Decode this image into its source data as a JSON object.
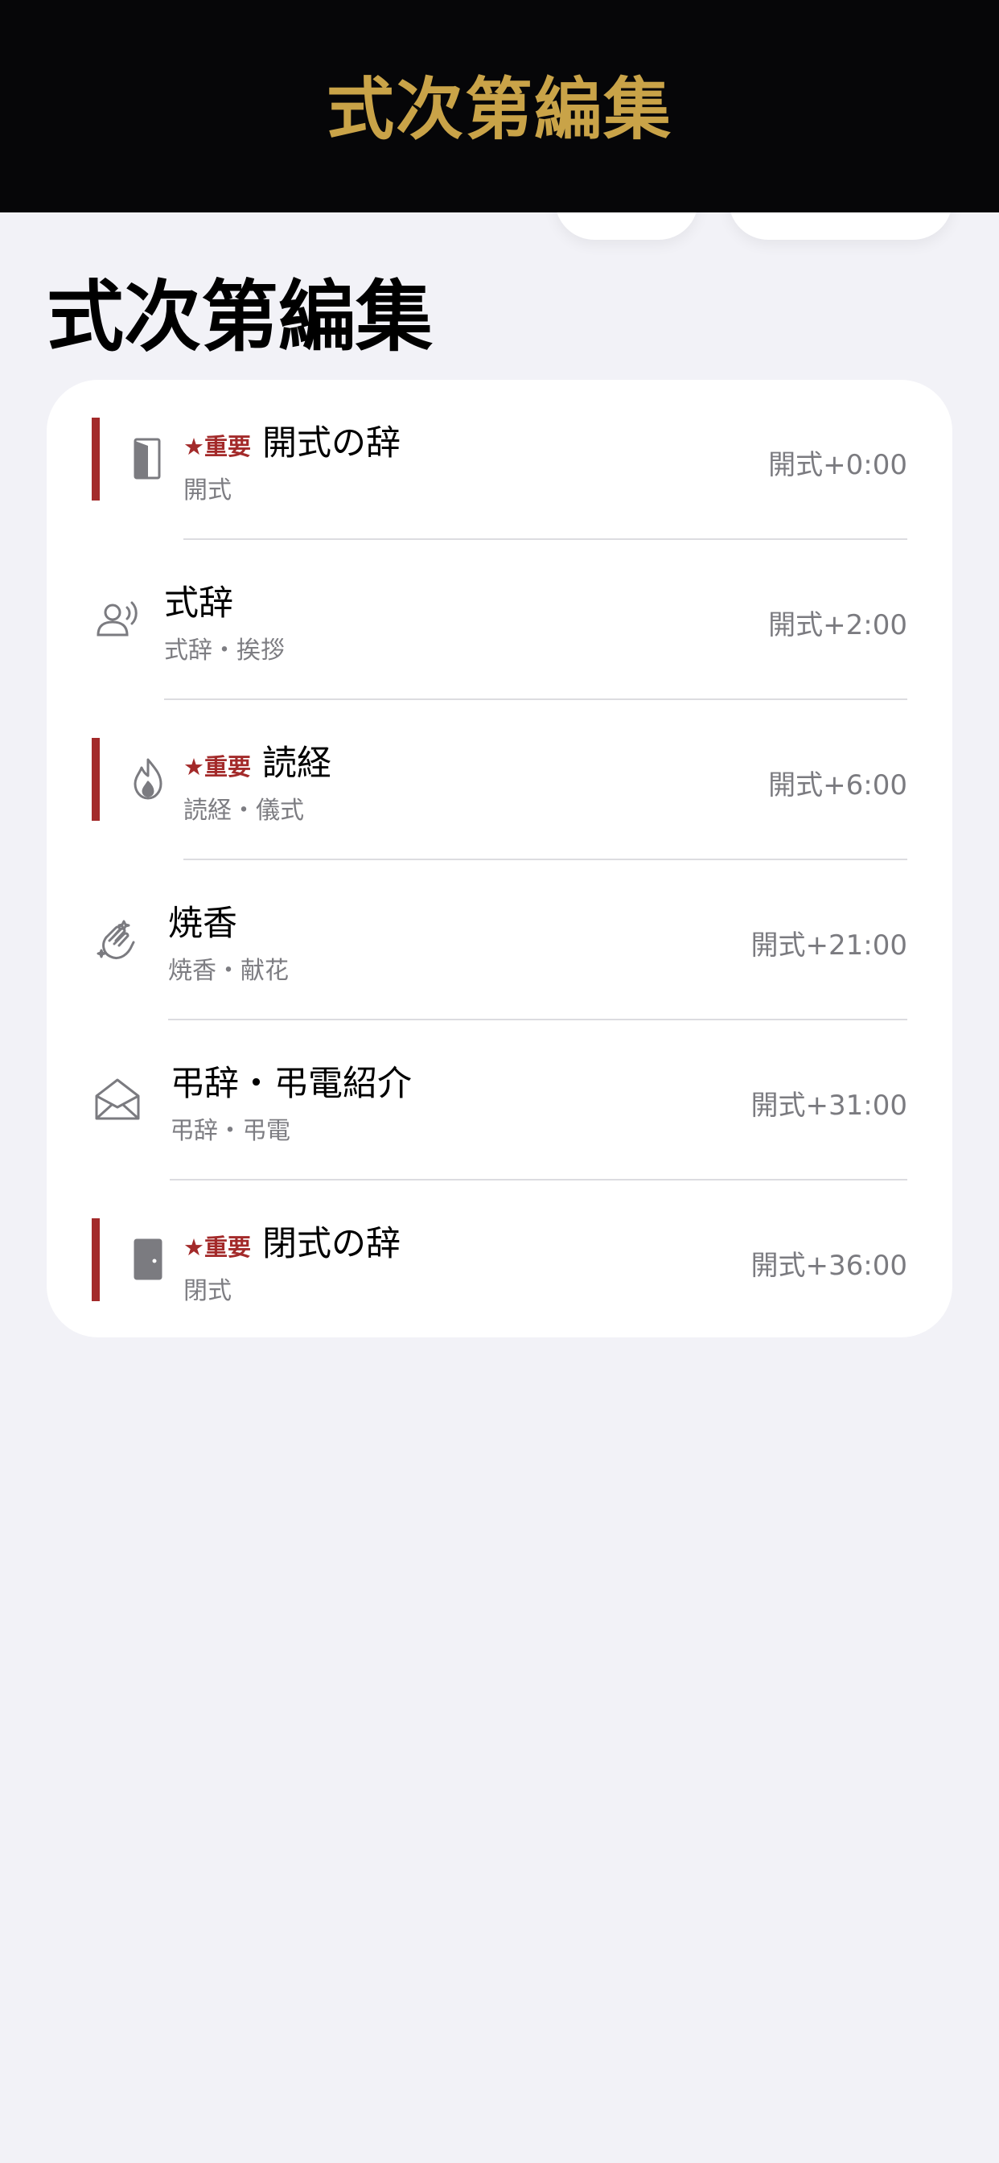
{
  "header": {
    "title": "式次第編集"
  },
  "page": {
    "title": "式次第編集"
  },
  "schedule": [
    {
      "badge": "★重要",
      "name": "開式の辞",
      "category": "開式",
      "time": "開式+0:00",
      "important": true,
      "icon": "door-open-icon"
    },
    {
      "badge": "",
      "name": "式辞",
      "category": "式辞・挨拶",
      "time": "開式+2:00",
      "important": false,
      "icon": "person-speaking-icon"
    },
    {
      "badge": "★重要",
      "name": "読経",
      "category": "読経・儀式",
      "time": "開式+6:00",
      "important": true,
      "icon": "flame-icon"
    },
    {
      "badge": "",
      "name": "焼香",
      "category": "焼香・献花",
      "time": "開式+21:00",
      "important": false,
      "icon": "hands-clap-icon"
    },
    {
      "badge": "",
      "name": "弔辞・弔電紹介",
      "category": "弔辞・弔電",
      "time": "開式+31:00",
      "important": false,
      "icon": "envelope-open-icon"
    },
    {
      "badge": "★重要",
      "name": "閉式の辞",
      "category": "閉式",
      "time": "開式+36:00",
      "important": true,
      "icon": "door-closed-icon"
    }
  ],
  "colors": {
    "header_bg": "#060608",
    "header_title": "#c9a348",
    "important_accent": "#a32a2a",
    "background": "#f2f2f7"
  }
}
